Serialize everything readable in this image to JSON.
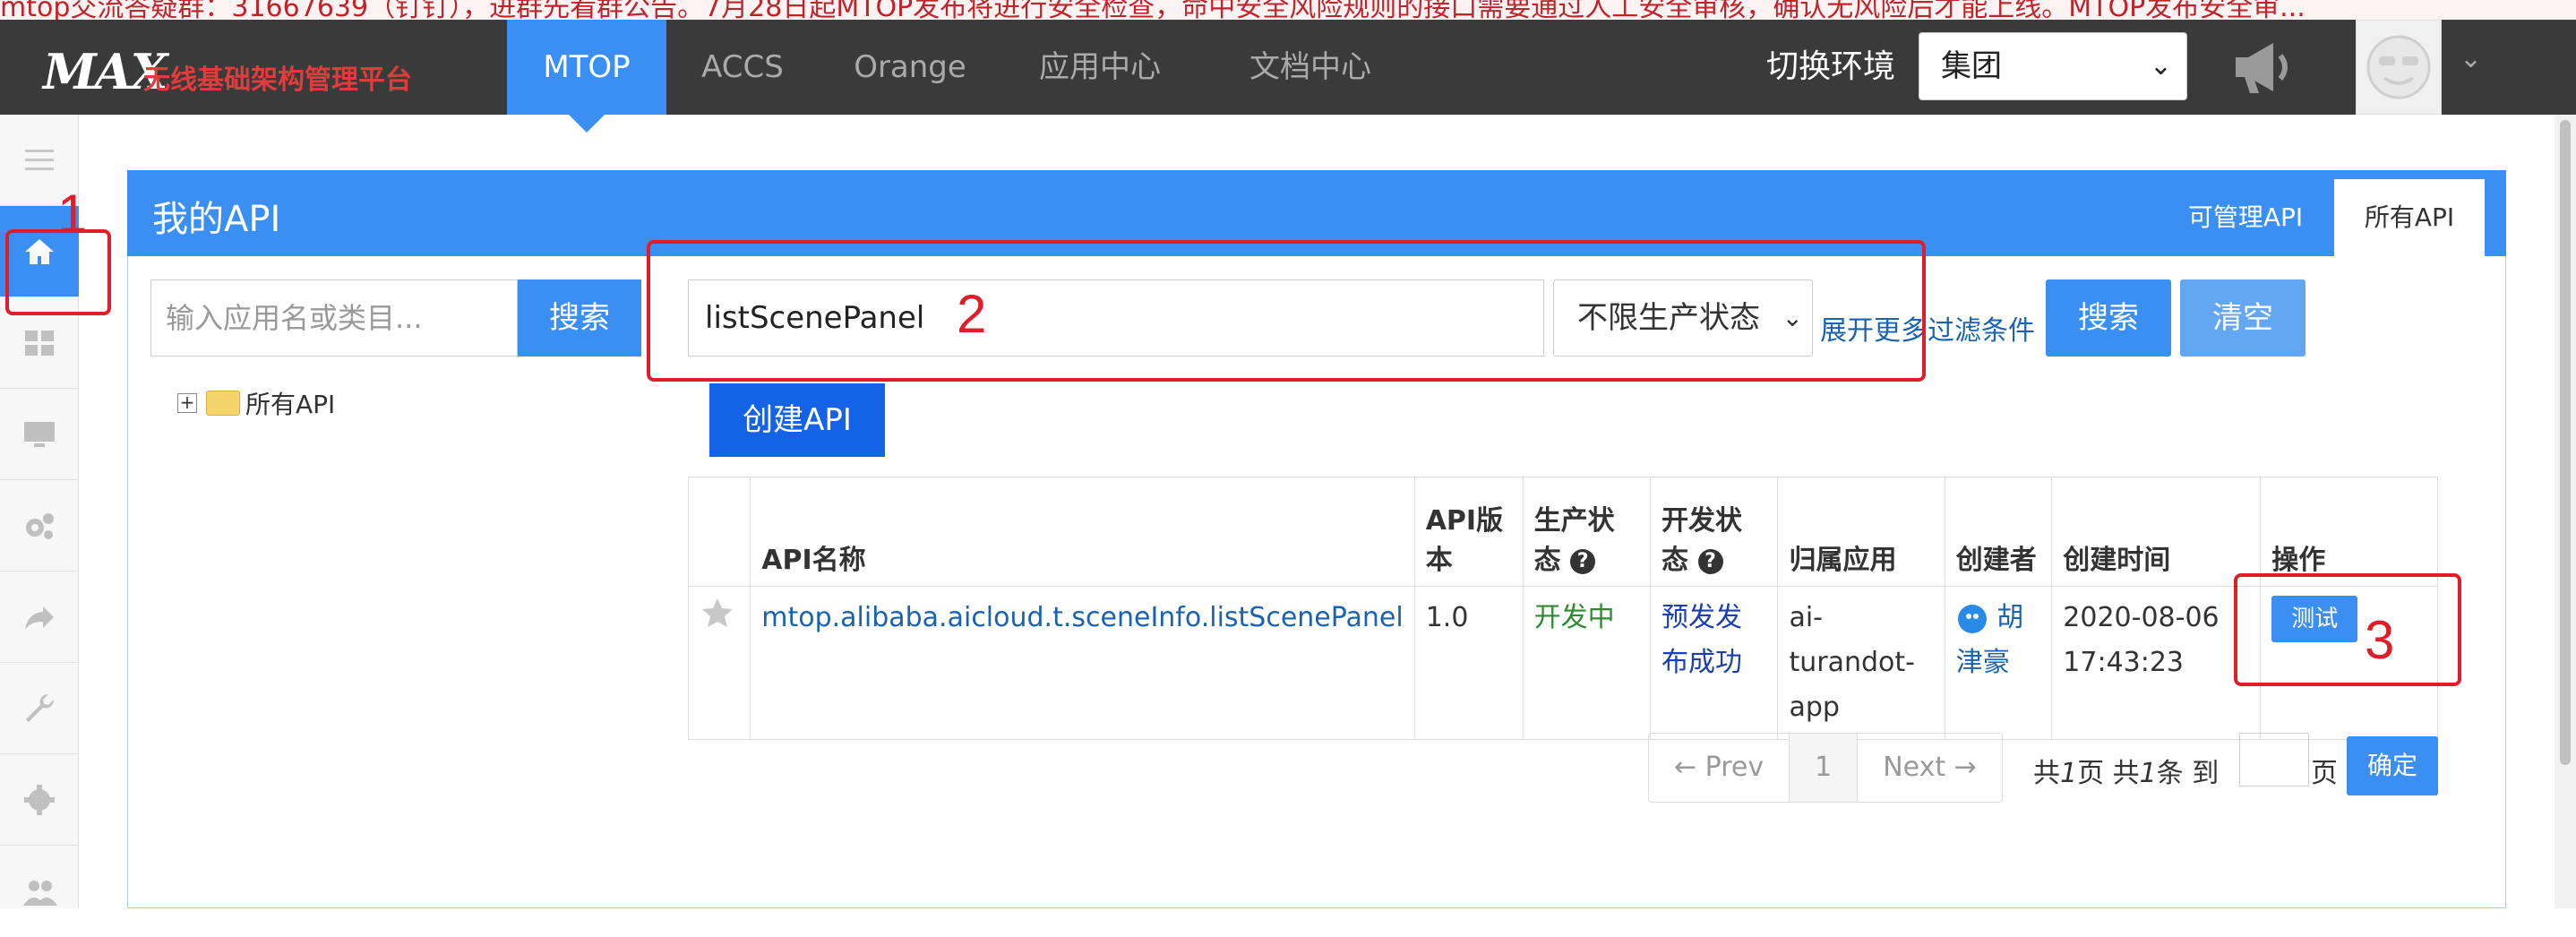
{
  "banner": {
    "text": "mtop交流答疑群：31667639（钉钉），进群先看群公告。7月28日起MTOP发布将进行安全检查，命中安全风险规则的接口需要通过人工安全审核，确认无风险后才能上线。MTOP发布安全审..."
  },
  "topnav": {
    "logo": "MAX",
    "logo_sub": "无线基础架构管理平台",
    "tabs": [
      {
        "label": "MTOP",
        "active": true
      },
      {
        "label": "ACCS",
        "active": false
      },
      {
        "label": "Orange",
        "active": false
      },
      {
        "label": "应用中心",
        "active": false
      },
      {
        "label": "文档中心",
        "active": false
      }
    ],
    "env_label": "切换环境",
    "env_value": "集团"
  },
  "sidebar": {
    "icons": [
      "menu-icon",
      "home-icon",
      "grid-icon",
      "monitor-icon",
      "gears-icon",
      "share-icon",
      "wrench-icon",
      "gear-icon",
      "users-icon"
    ],
    "active": "home-icon"
  },
  "panel": {
    "title": "我的API",
    "tabs": [
      {
        "label": "可管理API",
        "active": false
      },
      {
        "label": "所有API",
        "active": true
      }
    ]
  },
  "left": {
    "search_placeholder": "输入应用名或类目...",
    "search_button": "搜索",
    "tree_root": "所有API"
  },
  "query": {
    "api_value": "listScenePanel",
    "status_value": "不限生产状态",
    "more_filters": "展开更多过滤条件",
    "search_button": "搜索",
    "clear_button": "清空",
    "create_button": "创建API"
  },
  "table": {
    "headers": [
      "",
      "API名称",
      "API版本",
      "生产状态",
      "开发状态",
      "归属应用",
      "创建者",
      "创建时间",
      "操作"
    ],
    "rows": [
      {
        "name": "mtop.alibaba.aicloud.t.sceneInfo.listScenePanel",
        "version": "1.0",
        "prod_status": "开发中",
        "dev_status": "预发发布成功",
        "app": "ai-turandot-app",
        "creator": "胡津豪",
        "created": "2020-08-06 17:43:23",
        "action": "测试"
      }
    ]
  },
  "pagination": {
    "prev": "← Prev",
    "page": "1",
    "next": "Next →",
    "info_prefix": "共",
    "info_pages": "1",
    "info_mid": "页 共",
    "info_items": "1",
    "info_suffix": "条 到",
    "page_unit": "页",
    "confirm": "确定"
  },
  "annotations": {
    "one": "1",
    "two": "2",
    "three": "3"
  },
  "colors": {
    "accent": "#3b8ef2",
    "nav_bg": "#3a3a3a",
    "annotation": "#e11d2a",
    "status_green": "#2e8b2e",
    "link": "#1a63b0"
  }
}
